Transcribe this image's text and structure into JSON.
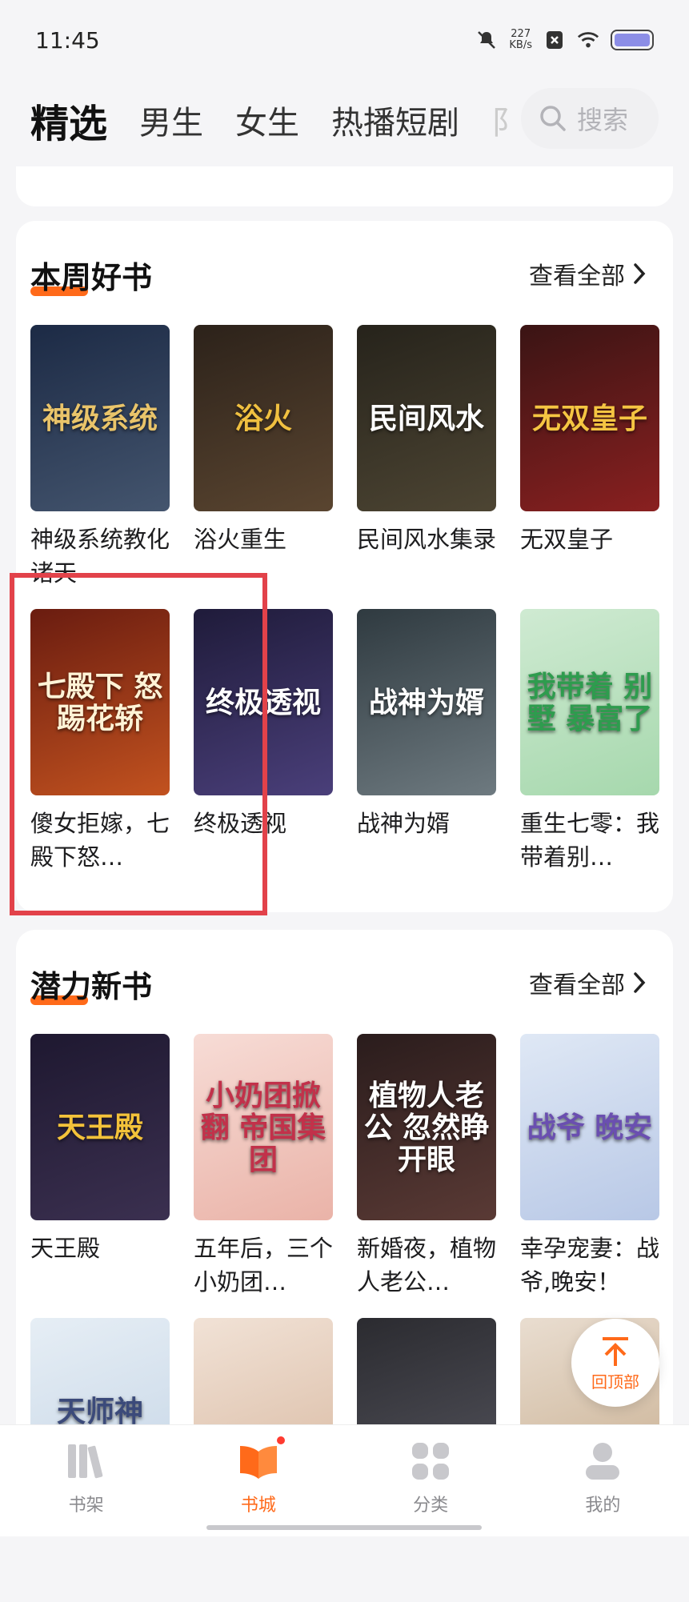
{
  "status": {
    "time": "11:45",
    "net_speed": "227",
    "net_unit": "KB/s"
  },
  "tabs": [
    {
      "label": "精选",
      "active": true
    },
    {
      "label": "男生"
    },
    {
      "label": "女生"
    },
    {
      "label": "热播短剧"
    },
    {
      "label": "阝"
    }
  ],
  "search": {
    "placeholder": "搜索"
  },
  "sections": [
    {
      "title": "本周好书",
      "view_all": "查看全部",
      "books": [
        {
          "title": "神级系统教化诸天",
          "cover_text": "神级系统",
          "colors": [
            "#1c2a45",
            "#44556e"
          ],
          "text_color": "#e9c46a"
        },
        {
          "title": "浴火重生",
          "cover_text": "浴火",
          "colors": [
            "#2c221a",
            "#5a4530"
          ],
          "text_color": "#f0c040"
        },
        {
          "title": "民间风水集录",
          "cover_text": "民间风水",
          "colors": [
            "#26231b",
            "#4d4533"
          ],
          "text_color": "#ffffff"
        },
        {
          "title": "无双皇子",
          "cover_text": "无双皇子",
          "colors": [
            "#3a1414",
            "#8a2020"
          ],
          "text_color": "#f5c542"
        },
        {
          "title": "傻女拒嫁，七殿下怒…",
          "cover_text": "七殿下 怒踢花轿",
          "colors": [
            "#6a1c10",
            "#c2521f"
          ],
          "text_color": "#fff3d6"
        },
        {
          "title": "终极透视",
          "cover_text": "终极透视",
          "colors": [
            "#1f1b3a",
            "#4a3f7a"
          ],
          "text_color": "#ffffff"
        },
        {
          "title": "战神为婿",
          "cover_text": "战神为婿",
          "colors": [
            "#2f3a40",
            "#6e7a80"
          ],
          "text_color": "#ffffff"
        },
        {
          "title": "重生七零：我带着别…",
          "cover_text": "我带着 别墅 暴富了",
          "colors": [
            "#cfead2",
            "#a6d8ad"
          ],
          "text_color": "#2e9c4e"
        }
      ]
    },
    {
      "title": "潜力新书",
      "view_all": "查看全部",
      "books": [
        {
          "title": "天王殿",
          "cover_text": "天王殿",
          "colors": [
            "#1e1830",
            "#3b3050"
          ],
          "text_color": "#f3c23a"
        },
        {
          "title": "五年后，三个小奶团…",
          "cover_text": "小奶团掀翻 帝国集团",
          "colors": [
            "#f7dcd6",
            "#eab3a8"
          ],
          "text_color": "#c2314a"
        },
        {
          "title": "新婚夜，植物人老公…",
          "cover_text": "植物人老公 忽然睁开眼",
          "colors": [
            "#2a1c1c",
            "#5a3a35"
          ],
          "text_color": "#ffffff"
        },
        {
          "title": "幸孕宠妻：战爷,晚安！",
          "cover_text": "战爷 晚安",
          "colors": [
            "#dfe8f5",
            "#b8c8e6"
          ],
          "text_color": "#6a4fb0"
        },
        {
          "title": "",
          "cover_text": "天师神",
          "colors": [
            "#e6eef5",
            "#c5d5e6"
          ],
          "text_color": "#3b4a7a"
        },
        {
          "title": "",
          "cover_text": "",
          "colors": [
            "#f1e2d6",
            "#d8b8a0"
          ],
          "text_color": "#ffffff"
        },
        {
          "title": "",
          "cover_text": "",
          "colors": [
            "#2b2b30",
            "#55555e"
          ],
          "text_color": "#ffffff"
        },
        {
          "title": "",
          "cover_text": "",
          "colors": [
            "#e9ddd0",
            "#c7ad8e"
          ],
          "text_color": "#ffffff"
        }
      ]
    }
  ],
  "back_top": {
    "label": "回顶部"
  },
  "bottom_nav": [
    {
      "label": "书架",
      "icon": "bookshelf-icon"
    },
    {
      "label": "书城",
      "icon": "bookstore-icon",
      "active": true
    },
    {
      "label": "分类",
      "icon": "category-icon"
    },
    {
      "label": "我的",
      "icon": "profile-icon"
    }
  ],
  "accent_color": "#ff6a1a"
}
